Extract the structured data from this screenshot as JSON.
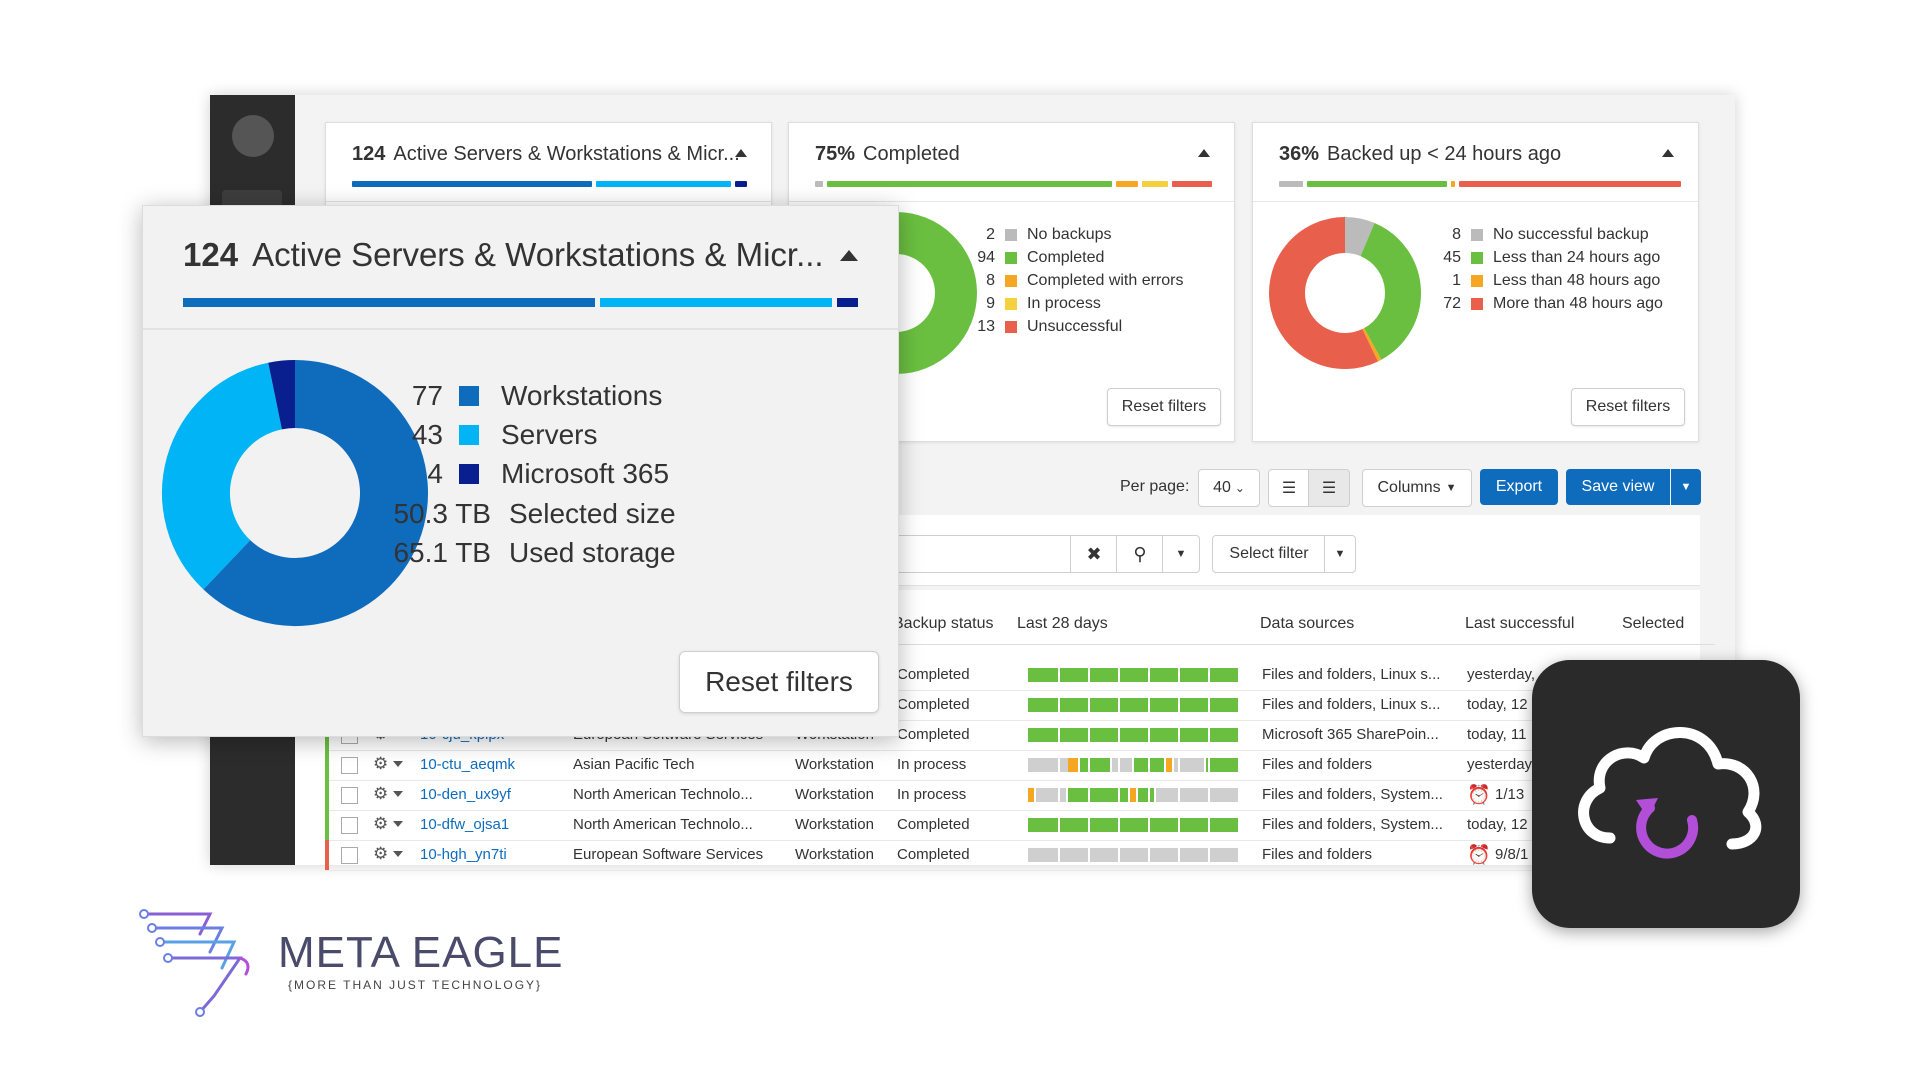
{
  "cards": [
    {
      "count": "124",
      "title": "Active Servers & Workstations & Micr...",
      "segments": [
        {
          "color": "#0f6cbd",
          "w": 240
        },
        {
          "color": "#00b4f5",
          "w": 135
        },
        {
          "color": "#0a1f8f",
          "w": 12
        }
      ]
    },
    {
      "count": "75%",
      "title": "Completed",
      "segments": [
        {
          "color": "#bbbbbb",
          "w": 8
        },
        {
          "color": "#6abf40",
          "w": 285
        },
        {
          "color": "#f5a623",
          "w": 22
        },
        {
          "color": "#f4d03f",
          "w": 26
        },
        {
          "color": "#e8604c",
          "w": 40
        }
      ],
      "legend": [
        {
          "num": "2",
          "label": "No backups",
          "color": "#bbbbbb"
        },
        {
          "num": "94",
          "label": "Completed",
          "color": "#6abf40"
        },
        {
          "num": "8",
          "label": "Completed with errors",
          "color": "#f5a623"
        },
        {
          "num": "9",
          "label": "In process",
          "color": "#f4d03f"
        },
        {
          "num": "13",
          "label": "Unsuccessful",
          "color": "#e8604c"
        }
      ],
      "reset_label": "Reset filters"
    },
    {
      "count": "36%",
      "title": "Backed up < 24 hours ago",
      "segments": [
        {
          "color": "#bbbbbb",
          "w": 24
        },
        {
          "color": "#6abf40",
          "w": 140
        },
        {
          "color": "#f5a623",
          "w": 4
        },
        {
          "color": "#e8604c",
          "w": 222
        }
      ],
      "legend": [
        {
          "num": "8",
          "label": "No successful backup",
          "color": "#bbbbbb"
        },
        {
          "num": "45",
          "label": "Less than 24 hours ago",
          "color": "#6abf40"
        },
        {
          "num": "1",
          "label": "Less than 48 hours ago",
          "color": "#f5a623"
        },
        {
          "num": "72",
          "label": "More than 48 hours ago",
          "color": "#e8604c"
        }
      ],
      "reset_label": "Reset filters"
    }
  ],
  "big_card": {
    "count": "124",
    "title": "Active Servers & Workstations & Micr...",
    "legend": [
      {
        "num": "77",
        "label": "Workstations",
        "color": "#0f6cbd"
      },
      {
        "num": "43",
        "label": "Servers",
        "color": "#00b4f5"
      },
      {
        "num": "4",
        "label": "Microsoft 365",
        "color": "#0a1f8f"
      }
    ],
    "sizes": [
      {
        "value": "50.3 TB",
        "label": "Selected size"
      },
      {
        "value": "65.1 TB",
        "label": "Used storage"
      }
    ],
    "reset_label": "Reset filters"
  },
  "toolbar": {
    "per_page_label": "Per page:",
    "per_page_value": "40",
    "columns_label": "Columns",
    "export_label": "Export",
    "save_view_label": "Save view",
    "select_filter_label": "Select filter"
  },
  "table": {
    "headers": {
      "backup_status": "Backup status",
      "last_28_days": "Last 28 days",
      "data_sources": "Data sources",
      "last_successful": "Last successful",
      "selected": "Selected"
    },
    "rows": [
      {
        "mark": "",
        "name": "",
        "company": "",
        "type": "",
        "status": "Completed",
        "days": "green",
        "sources": "Files and folders, Linux s...",
        "last": "yesterday,",
        "alert": false
      },
      {
        "mark": "",
        "name": "",
        "company": "",
        "type": "",
        "status": "Completed",
        "days": "green",
        "sources": "Files and folders, Linux s...",
        "last": "today, 12",
        "alert": false
      },
      {
        "mark": "#6abf40",
        "name": "10-cju_kpipx",
        "company": "European Software Services",
        "type": "Workstation",
        "status": "Completed",
        "days": "green",
        "sources": "Microsoft 365 SharePoin...",
        "last": "today, 11",
        "alert": false
      },
      {
        "mark": "#6abf40",
        "name": "10-ctu_aeqmk",
        "company": "Asian Pacific Tech",
        "type": "Workstation",
        "status": "In process",
        "days": "mixed",
        "sources": "Files and folders",
        "last": "yesterday",
        "alert": false
      },
      {
        "mark": "#6abf40",
        "name": "10-den_ux9yf",
        "company": "North American Technolo...",
        "type": "Workstation",
        "status": "In process",
        "days": "mixed2",
        "sources": "Files and folders, System...",
        "last": "1/13",
        "alert": true
      },
      {
        "mark": "#6abf40",
        "name": "10-dfw_ojsa1",
        "company": "North American Technolo...",
        "type": "Workstation",
        "status": "Completed",
        "days": "green",
        "sources": "Files and folders, System...",
        "last": "today, 12",
        "alert": false
      },
      {
        "mark": "#e8604c",
        "name": "10-hgh_yn7ti",
        "company": "European Software Services",
        "type": "Workstation",
        "status": "Completed",
        "days": "grey",
        "sources": "Files and folders",
        "last": "9/8/1",
        "alert": true
      }
    ]
  },
  "logo": {
    "brand": "META EAGLE",
    "tagline": "{MORE THAN JUST TECHNOLOGY}"
  },
  "colors": {
    "accent": "#0f6cbd",
    "workstations": "#0f6cbd",
    "servers": "#00b4f5",
    "m365": "#0a1f8f",
    "green": "#6abf40",
    "orange": "#f5a623",
    "yellow": "#f4d03f",
    "red": "#e8604c",
    "grey": "#bbbbbb",
    "icon_purple": "#b14fd8"
  },
  "icons": [
    "gear-icon",
    "clear-icon",
    "search-icon",
    "chevron-down-icon",
    "list-view-icon",
    "grid-view-icon",
    "cloud-backup-icon",
    "alert-clock-icon"
  ]
}
